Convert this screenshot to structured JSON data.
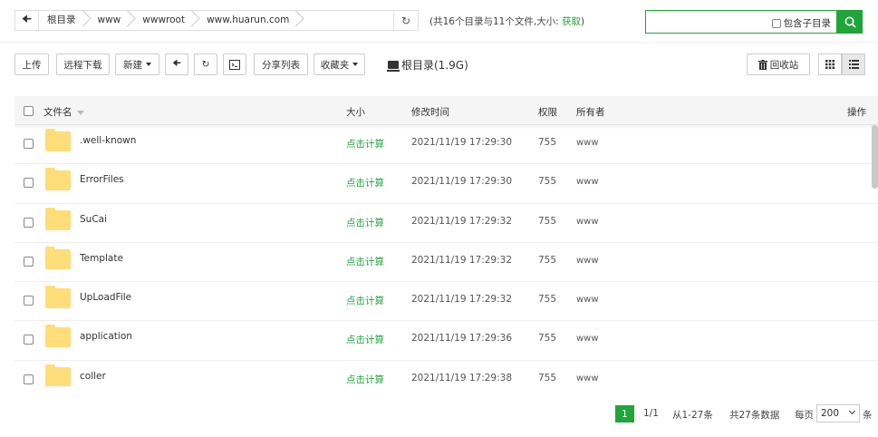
{
  "breadcrumb": {
    "back_icon": "arrow-left-icon",
    "items": [
      "根目录",
      "www",
      "wwwroot",
      "www.huarun.com"
    ]
  },
  "dir_info": {
    "text": "(共16个目录与11个文件,大小: ",
    "link": "获取",
    "close": ")"
  },
  "search": {
    "value": "",
    "subdir_label": "包含子目录"
  },
  "toolbar": {
    "upload": "上传",
    "remote_download": "远程下载",
    "new": "新建",
    "share_list": "分享列表",
    "favorites": "收藏夹",
    "disk_label": "根目录(1.9G)",
    "recycle_bin": "回收站"
  },
  "table": {
    "headers": {
      "name": "文件名",
      "size": "大小",
      "mtime": "修改时间",
      "perm": "权限",
      "owner": "所有者",
      "action": "操作"
    },
    "rows": [
      {
        "name": ".well-known",
        "size": "点击计算",
        "mtime": "2021/11/19 17:29:30",
        "perm": "755",
        "owner": "www"
      },
      {
        "name": "ErrorFiles",
        "size": "点击计算",
        "mtime": "2021/11/19 17:29:30",
        "perm": "755",
        "owner": "www"
      },
      {
        "name": "SuCai",
        "size": "点击计算",
        "mtime": "2021/11/19 17:29:32",
        "perm": "755",
        "owner": "www"
      },
      {
        "name": "Template",
        "size": "点击计算",
        "mtime": "2021/11/19 17:29:32",
        "perm": "755",
        "owner": "www"
      },
      {
        "name": "UpLoadFile",
        "size": "点击计算",
        "mtime": "2021/11/19 17:29:32",
        "perm": "755",
        "owner": "www"
      },
      {
        "name": "application",
        "size": "点击计算",
        "mtime": "2021/11/19 17:29:36",
        "perm": "755",
        "owner": "www"
      },
      {
        "name": "coller",
        "size": "点击计算",
        "mtime": "2021/11/19 17:29:38",
        "perm": "755",
        "owner": "www"
      }
    ]
  },
  "pagination": {
    "current": "1",
    "pages": "1/1",
    "range": "从1-27条",
    "total": "共27条数据",
    "per_page_label": "每页",
    "per_page_value": "200",
    "unit": "条"
  },
  "colors": {
    "accent": "#20a53a",
    "folder": "#ffdd78"
  }
}
